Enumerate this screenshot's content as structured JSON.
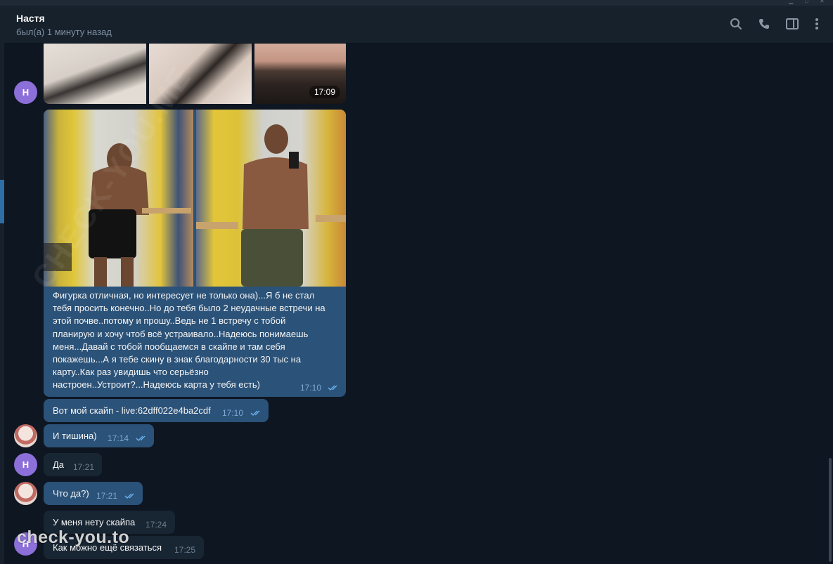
{
  "header": {
    "peer_name": "Настя",
    "peer_status": "был(а) 1 минуту назад",
    "icons": [
      "search-icon",
      "phone-icon",
      "sidebar-icon",
      "more-icon"
    ]
  },
  "avatars": {
    "peer_initial": "Н"
  },
  "messages": [
    {
      "type": "album-top",
      "time": "17:09"
    },
    {
      "type": "album",
      "caption": "Фигурка отличная, но интересует не только она)...Я б не стал тебя просить конечно..Но до тебя было 2 неудачные встречи на этой почве..потому и прошу..Ведь не 1 встречу с тобой планирую и хочу чтоб всё устраивало..Надеюсь понимаешь меня...Давай с тобой пообщаемся в скайпе и там себя покажешь...А я тебе скину в знак благодарности 30 тыс на карту..Как раз увидишь что серьёзно настроен..Устроит?...Надеюсь карта у тебя есть)",
      "caption_lines": [
        "Фигурка отличная, но интересует не только она)...Я б не стал",
        "тебя просить конечно..Но до тебя было 2 неудачные встречи на",
        "этой почве..потому и прошу..Ведь не 1 встречу с тобой",
        "планирую и хочу чтоб всё устраивало..Надеюсь понимаешь",
        "меня...Давай с тобой пообщаемся в скайпе и там себя",
        "покажешь...А я тебе скину в знак благодарности 30 тыс на",
        "карту..Как раз увидишь что серьёзно",
        "настроен..Устроит?...Надеюсь карта у тебя есть)"
      ],
      "time": "17:10"
    },
    {
      "type": "out",
      "text": "Вот мой скайп - live:62dff022e4ba2cdf",
      "time": "17:10"
    },
    {
      "type": "out",
      "text": "И тишина)",
      "time": "17:14"
    },
    {
      "type": "in",
      "text": "Да",
      "time": "17:21"
    },
    {
      "type": "out",
      "text": "Что да?)",
      "time": "17:21"
    },
    {
      "type": "in",
      "text": "У меня нету скайпа",
      "time": "17:24"
    },
    {
      "type": "in",
      "text": "Как можно ещё связаться",
      "time": "17:25"
    }
  ],
  "watermarks": {
    "diagonal": "CHECK-YOU.ME",
    "brand": "check-you.to"
  },
  "colors": {
    "background": "#0e1621",
    "header": "#17212b",
    "outgoing_bubble": "#2b5278",
    "incoming_bubble": "#182533",
    "avatar": "#8d6fd9",
    "read_ticks": "#6ab2f2"
  }
}
